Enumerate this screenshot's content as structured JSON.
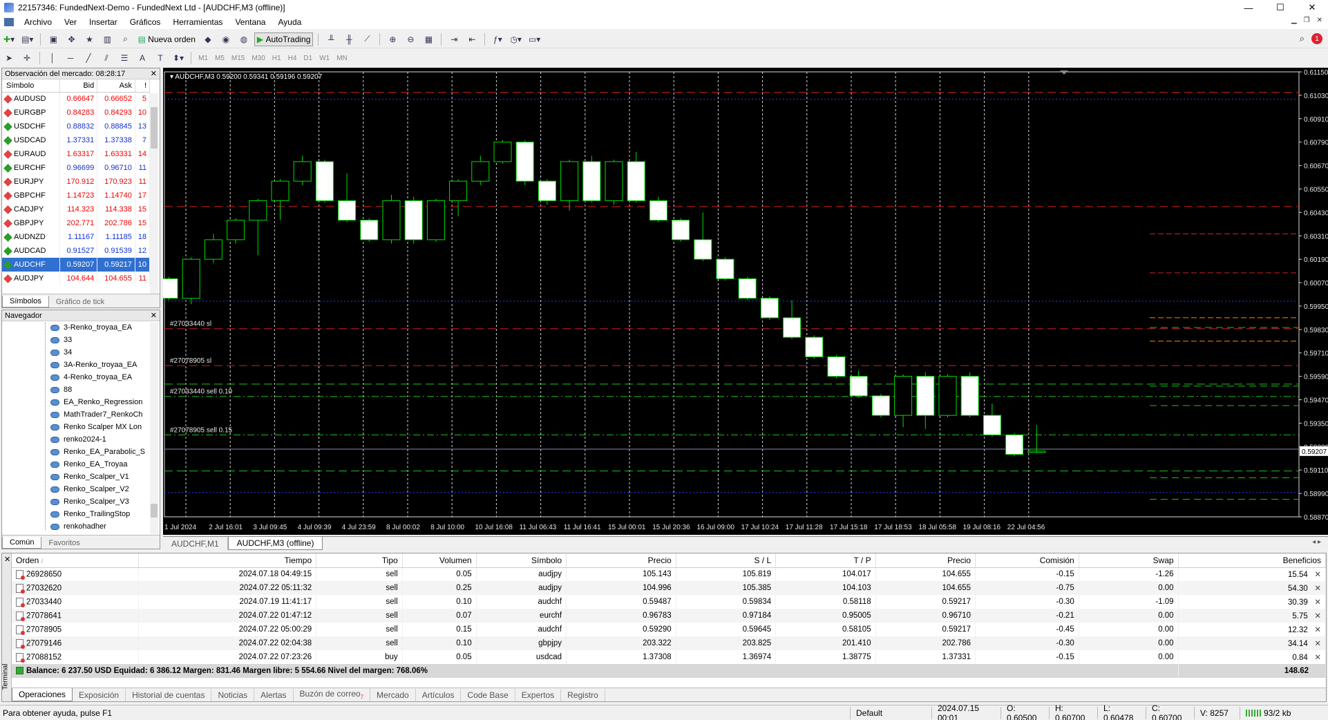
{
  "window": {
    "title": "22157346: FundedNext-Demo - FundedNext Ltd - [AUDCHF,M3 (offline)]",
    "minimize": "—",
    "maximize": "☐",
    "close": "✕"
  },
  "menu": [
    "Archivo",
    "Ver",
    "Insertar",
    "Gráficos",
    "Herramientas",
    "Ventana",
    "Ayuda"
  ],
  "toolbar": {
    "new_order": "Nueva orden",
    "autotrading": "AutoTrading",
    "timeframes": [
      "M1",
      "M5",
      "M15",
      "M30",
      "H1",
      "H4",
      "D1",
      "W1",
      "MN"
    ],
    "notifications": "1"
  },
  "market_watch": {
    "title": "Observación del mercado: 08:28:17",
    "headers": [
      "Símbolo",
      "Bid",
      "Ask",
      "!"
    ],
    "rows": [
      {
        "symbol": "AUDUSD",
        "dir": "dn",
        "bid": "0.66647",
        "ask": "0.66652",
        "spread": "5",
        "color": "red"
      },
      {
        "symbol": "EURGBP",
        "dir": "dn",
        "bid": "0.84283",
        "ask": "0.84293",
        "spread": "10",
        "color": "red"
      },
      {
        "symbol": "USDCHF",
        "dir": "up",
        "bid": "0.88832",
        "ask": "0.88845",
        "spread": "13",
        "color": "blue"
      },
      {
        "symbol": "USDCAD",
        "dir": "up",
        "bid": "1.37331",
        "ask": "1.37338",
        "spread": "7",
        "color": "blue"
      },
      {
        "symbol": "EURAUD",
        "dir": "dn",
        "bid": "1.63317",
        "ask": "1.63331",
        "spread": "14",
        "color": "red"
      },
      {
        "symbol": "EURCHF",
        "dir": "up",
        "bid": "0.96699",
        "ask": "0.96710",
        "spread": "11",
        "color": "blue"
      },
      {
        "symbol": "EURJPY",
        "dir": "dn",
        "bid": "170.912",
        "ask": "170.923",
        "spread": "11",
        "color": "red"
      },
      {
        "symbol": "GBPCHF",
        "dir": "dn",
        "bid": "1.14723",
        "ask": "1.14740",
        "spread": "17",
        "color": "red"
      },
      {
        "symbol": "CADJPY",
        "dir": "dn",
        "bid": "114.323",
        "ask": "114.338",
        "spread": "15",
        "color": "red"
      },
      {
        "symbol": "GBPJPY",
        "dir": "dn",
        "bid": "202.771",
        "ask": "202.786",
        "spread": "15",
        "color": "red"
      },
      {
        "symbol": "AUDNZD",
        "dir": "up",
        "bid": "1.11167",
        "ask": "1.11185",
        "spread": "18",
        "color": "blue"
      },
      {
        "symbol": "AUDCAD",
        "dir": "up",
        "bid": "0.91527",
        "ask": "0.91539",
        "spread": "12",
        "color": "blue"
      },
      {
        "symbol": "AUDCHF",
        "dir": "up",
        "bid": "0.59207",
        "ask": "0.59217",
        "spread": "10",
        "color": "blue",
        "selected": true
      },
      {
        "symbol": "AUDJPY",
        "dir": "dn",
        "bid": "104.644",
        "ask": "104.655",
        "spread": "11",
        "color": "red"
      }
    ],
    "tabs": [
      "Símbolos",
      "Gráfico de tick"
    ]
  },
  "navigator": {
    "title": "Navegador",
    "items": [
      "3-Renko_troyaa_EA",
      "33",
      "34",
      "3A-Renko_troyaa_EA",
      "4-Renko_troyaa_EA",
      "88",
      "EA_Renko_Regression",
      "MathTrader7_RenkoCh",
      "Renko Scalper MX Lon",
      "renko2024-1",
      "Renko_EA_Parabolic_S",
      "Renko_EA_Troyaa",
      "Renko_Scalper_V1",
      "Renko_Scalper_V2",
      "Renko_Scalper_V3",
      "Renko_TrailingStop",
      "renkohadher"
    ],
    "tabs": [
      "Común",
      "Favoritos"
    ]
  },
  "chart_data": {
    "type": "candlestick",
    "symbol_header": "AUDCHF,M3  0.59200 0.59341 0.59196 0.59207",
    "ylim": [
      0.5887,
      0.6115
    ],
    "y_ticks": [
      "0.61150",
      "0.61030",
      "0.60910",
      "0.60790",
      "0.60670",
      "0.60550",
      "0.60430",
      "0.60310",
      "0.60190",
      "0.60070",
      "0.59950",
      "0.59830",
      "0.59710",
      "0.59590",
      "0.59470",
      "0.59350",
      "0.59230",
      "0.59110",
      "0.58990",
      "0.58870"
    ],
    "y_tick_values": [
      0.6115,
      0.6103,
      0.6091,
      0.6079,
      0.6067,
      0.6055,
      0.6043,
      0.6031,
      0.6019,
      0.6007,
      0.5995,
      0.5983,
      0.5971,
      0.5959,
      0.5947,
      0.5935,
      0.5923,
      0.5911,
      0.5899,
      0.5887
    ],
    "x_ticks": [
      "1 Jul 2024",
      "2 Jul 16:01",
      "3 Jul 09:45",
      "4 Jul 09:39",
      "4 Jul 23:59",
      "8 Jul 00:02",
      "8 Jul 10:00",
      "10 Jul 16:08",
      "11 Jul 06:43",
      "11 Jul 16:41",
      "15 Jul 00:01",
      "15 Jul 20:36",
      "16 Jul 09:00",
      "17 Jul 10:24",
      "17 Jul 11:28",
      "17 Jul 15:18",
      "17 Jul 18:53",
      "18 Jul 05:58",
      "19 Jul 08:16",
      "22 Jul 04:56"
    ],
    "current_price": "0.59207",
    "candles": [
      {
        "o": 0.6009,
        "c": 0.5999,
        "h": 0.601,
        "l": 0.5998
      },
      {
        "o": 0.5999,
        "c": 0.6019,
        "h": 0.602,
        "l": 0.5996
      },
      {
        "o": 0.6019,
        "c": 0.6029,
        "h": 0.6032,
        "l": 0.6017
      },
      {
        "o": 0.6029,
        "c": 0.6039,
        "h": 0.604,
        "l": 0.6027
      },
      {
        "o": 0.6039,
        "c": 0.6049,
        "h": 0.605,
        "l": 0.6021
      },
      {
        "o": 0.6049,
        "c": 0.6059,
        "h": 0.606,
        "l": 0.6039
      },
      {
        "o": 0.6059,
        "c": 0.6069,
        "h": 0.6072,
        "l": 0.6057
      },
      {
        "o": 0.6069,
        "c": 0.6049,
        "h": 0.607,
        "l": 0.6048
      },
      {
        "o": 0.6049,
        "c": 0.6039,
        "h": 0.6063,
        "l": 0.6038
      },
      {
        "o": 0.6039,
        "c": 0.6029,
        "h": 0.604,
        "l": 0.6028
      },
      {
        "o": 0.6029,
        "c": 0.6049,
        "h": 0.6052,
        "l": 0.6027
      },
      {
        "o": 0.6049,
        "c": 0.6029,
        "h": 0.6051,
        "l": 0.6027
      },
      {
        "o": 0.6029,
        "c": 0.6049,
        "h": 0.605,
        "l": 0.6028
      },
      {
        "o": 0.6049,
        "c": 0.6059,
        "h": 0.606,
        "l": 0.6041
      },
      {
        "o": 0.6059,
        "c": 0.6069,
        "h": 0.6072,
        "l": 0.6057
      },
      {
        "o": 0.6069,
        "c": 0.6079,
        "h": 0.608,
        "l": 0.6068
      },
      {
        "o": 0.6079,
        "c": 0.6059,
        "h": 0.608,
        "l": 0.6057
      },
      {
        "o": 0.6059,
        "c": 0.6049,
        "h": 0.606,
        "l": 0.6047
      },
      {
        "o": 0.6049,
        "c": 0.6069,
        "h": 0.607,
        "l": 0.6044
      },
      {
        "o": 0.6069,
        "c": 0.6049,
        "h": 0.6072,
        "l": 0.6048
      },
      {
        "o": 0.6049,
        "c": 0.6069,
        "h": 0.607,
        "l": 0.6047
      },
      {
        "o": 0.6069,
        "c": 0.6049,
        "h": 0.6074,
        "l": 0.6048
      },
      {
        "o": 0.6049,
        "c": 0.6039,
        "h": 0.6051,
        "l": 0.6038
      },
      {
        "o": 0.6039,
        "c": 0.6029,
        "h": 0.604,
        "l": 0.6028
      },
      {
        "o": 0.6029,
        "c": 0.6019,
        "h": 0.6043,
        "l": 0.6018
      },
      {
        "o": 0.6019,
        "c": 0.6009,
        "h": 0.602,
        "l": 0.6008
      },
      {
        "o": 0.6009,
        "c": 0.5999,
        "h": 0.601,
        "l": 0.5998
      },
      {
        "o": 0.5999,
        "c": 0.5989,
        "h": 0.6,
        "l": 0.5988
      },
      {
        "o": 0.5989,
        "c": 0.5979,
        "h": 0.5998,
        "l": 0.5978
      },
      {
        "o": 0.5979,
        "c": 0.5969,
        "h": 0.598,
        "l": 0.5968
      },
      {
        "o": 0.5969,
        "c": 0.5959,
        "h": 0.597,
        "l": 0.5958
      },
      {
        "o": 0.5959,
        "c": 0.5949,
        "h": 0.5962,
        "l": 0.5948
      },
      {
        "o": 0.5949,
        "c": 0.5939,
        "h": 0.595,
        "l": 0.5938
      },
      {
        "o": 0.5939,
        "c": 0.5959,
        "h": 0.596,
        "l": 0.5933
      },
      {
        "o": 0.5959,
        "c": 0.5939,
        "h": 0.5961,
        "l": 0.5932
      },
      {
        "o": 0.5939,
        "c": 0.5959,
        "h": 0.596,
        "l": 0.5938
      },
      {
        "o": 0.5959,
        "c": 0.5939,
        "h": 0.5961,
        "l": 0.5938
      },
      {
        "o": 0.5939,
        "c": 0.5929,
        "h": 0.5945,
        "l": 0.5928
      },
      {
        "o": 0.5929,
        "c": 0.5919,
        "h": 0.593,
        "l": 0.5918
      },
      {
        "o": 0.592,
        "c": 0.59207,
        "h": 0.59341,
        "l": 0.59196
      }
    ],
    "hlines": [
      {
        "price": 0.61045,
        "color": "#d42020",
        "style": "dash"
      },
      {
        "price": 0.6101,
        "color": "#2040ff",
        "style": "dot"
      },
      {
        "price": 0.6046,
        "color": "#d42020",
        "style": "dash"
      },
      {
        "price": 0.59975,
        "color": "#2040ff",
        "style": "dot"
      },
      {
        "price": 0.59834,
        "color": "#d42020",
        "style": "dash",
        "label": "#27033440 sl"
      },
      {
        "price": 0.59645,
        "color": "#d42020",
        "style": "dash",
        "label": "#27078905 sl"
      },
      {
        "price": 0.5955,
        "color": "#20c020",
        "style": "dash"
      },
      {
        "price": 0.59487,
        "color": "#20c020",
        "style": "dashdot",
        "label": "#27033440 sell 0.10"
      },
      {
        "price": 0.5929,
        "color": "#20c020",
        "style": "dashdot",
        "label": "#27078905 sell 0.15"
      },
      {
        "price": 0.59217,
        "color": "#8090b0",
        "style": "solid"
      },
      {
        "price": 0.59105,
        "color": "#20c020",
        "style": "dash"
      },
      {
        "price": 0.58995,
        "color": "#2040ff",
        "style": "dot"
      }
    ],
    "short_hlines": [
      {
        "price": 0.6032,
        "color": "#d42020"
      },
      {
        "price": 0.6012,
        "color": "#d42020"
      },
      {
        "price": 0.5989,
        "color": "#ff8800"
      },
      {
        "price": 0.5984,
        "color": "#20c020"
      },
      {
        "price": 0.5977,
        "color": "#ff8800"
      },
      {
        "price": 0.5954,
        "color": "#20c020"
      },
      {
        "price": 0.5944,
        "color": "#20c020"
      },
      {
        "price": 0.5907,
        "color": "#20c020"
      },
      {
        "price": 0.5896,
        "color": "#20c020"
      }
    ]
  },
  "chart_tabs": [
    "AUDCHF,M1",
    "AUDCHF,M3 (offline)"
  ],
  "terminal": {
    "headers": {
      "order": "Orden",
      "time": "Tiempo",
      "type": "Tipo",
      "volume": "Volumen",
      "symbol": "Símbolo",
      "price": "Precio",
      "sl": "S / L",
      "tp": "T / P",
      "price2": "Precio",
      "commission": "Comisión",
      "swap": "Swap",
      "profit": "Beneficios"
    },
    "orders": [
      {
        "order": "26928650",
        "time": "2024.07.18 04:49:15",
        "type": "sell",
        "volume": "0.05",
        "symbol": "audjpy",
        "price": "105.143",
        "sl": "105.819",
        "tp": "104.017",
        "price2": "104.655",
        "commission": "-0.15",
        "swap": "-1.26",
        "profit": "15.54"
      },
      {
        "order": "27032620",
        "time": "2024.07.22 05:11:32",
        "type": "sell",
        "volume": "0.25",
        "symbol": "audjpy",
        "price": "104.996",
        "sl": "105.385",
        "tp": "104.103",
        "price2": "104.655",
        "commission": "-0.75",
        "swap": "0.00",
        "profit": "54.30"
      },
      {
        "order": "27033440",
        "time": "2024.07.19 11:41:17",
        "type": "sell",
        "volume": "0.10",
        "symbol": "audchf",
        "price": "0.59487",
        "sl": "0.59834",
        "tp": "0.58118",
        "price2": "0.59217",
        "commission": "-0.30",
        "swap": "-1.09",
        "profit": "30.39"
      },
      {
        "order": "27078641",
        "time": "2024.07.22 01:47:12",
        "type": "sell",
        "volume": "0.07",
        "symbol": "eurchf",
        "price": "0.96783",
        "sl": "0.97184",
        "tp": "0.95005",
        "price2": "0.96710",
        "commission": "-0.21",
        "swap": "0.00",
        "profit": "5.75"
      },
      {
        "order": "27078905",
        "time": "2024.07.22 05:00:29",
        "type": "sell",
        "volume": "0.15",
        "symbol": "audchf",
        "price": "0.59290",
        "sl": "0.59645",
        "tp": "0.58105",
        "price2": "0.59217",
        "commission": "-0.45",
        "swap": "0.00",
        "profit": "12.32"
      },
      {
        "order": "27079146",
        "time": "2024.07.22 02:04:38",
        "type": "sell",
        "volume": "0.10",
        "symbol": "gbpjpy",
        "price": "203.322",
        "sl": "203.825",
        "tp": "201.410",
        "price2": "202.786",
        "commission": "-0.30",
        "swap": "0.00",
        "profit": "34.14"
      },
      {
        "order": "27088152",
        "time": "2024.07.22 07:23:26",
        "type": "buy",
        "volume": "0.05",
        "symbol": "usdcad",
        "price": "1.37308",
        "sl": "1.36974",
        "tp": "1.38775",
        "price2": "1.37331",
        "commission": "-0.15",
        "swap": "0.00",
        "profit": "0.84"
      }
    ],
    "balance_line": "Balance: 6 237.50 USD  Equidad: 6 386.12  Margen: 831.46  Margen libre: 5 554.66  Nivel del margen: 768.06%",
    "total_profit": "148.62",
    "side_label": "Terminal",
    "tabs": [
      "Operaciones",
      "Exposición",
      "Historial de cuentas",
      "Noticias",
      "Alertas",
      "Buzón de correo",
      "Mercado",
      "Artículos",
      "Code Base",
      "Expertos",
      "Registro"
    ],
    "mail_count": "7"
  },
  "status": {
    "help": "Para obtener ayuda, pulse F1",
    "profile": "Default",
    "datetime": "2024.07.15 00:01",
    "open": "O: 0.60500",
    "high": "H: 0.60700",
    "low": "L: 0.60478",
    "close": "C: 0.60700",
    "volume": "V: 8257",
    "traffic": "93/2 kb"
  }
}
